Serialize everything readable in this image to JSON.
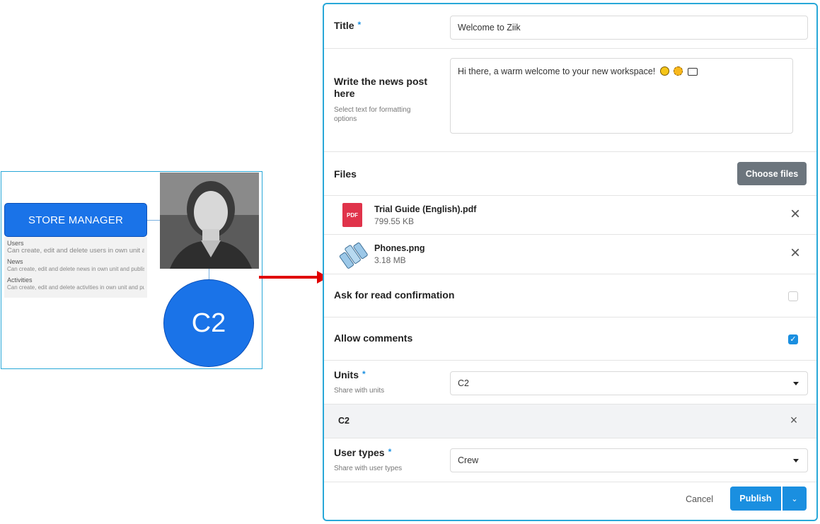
{
  "illustration": {
    "role_title": "STORE MANAGER",
    "permissions": [
      {
        "heading": "Users",
        "desc": "Can create, edit and delete users in own unit and below."
      },
      {
        "heading": "News",
        "desc": "Can create, edit and delete news in own unit and publish to own unit and below"
      },
      {
        "heading": "Activities",
        "desc": "Can create, edit and delete activities in own unit and publish to own unit and below"
      }
    ],
    "unit_label": "C2"
  },
  "form": {
    "title_label": "Title",
    "required_mark": "*",
    "title_value": "Welcome to Ziik",
    "post_label": "Write the news post here",
    "post_hint": "Select text for formatting options",
    "post_body": "Hi there, a warm welcome to your new workspace!",
    "files_label": "Files",
    "choose_files": "Choose files",
    "files": [
      {
        "name": "Trial Guide (English).pdf",
        "size": "799.55 KB",
        "icon": "pdf-icon",
        "badge": "PDF"
      },
      {
        "name": "Phones.png",
        "size": "3.18 MB",
        "icon": "image-thumbnail-icon"
      }
    ],
    "read_confirm_label": "Ask for read confirmation",
    "read_confirm_checked": false,
    "comments_label": "Allow comments",
    "comments_checked": true,
    "units_label": "Units",
    "units_hint": "Share with units",
    "units_value": "C2",
    "unit_chip": "C2",
    "user_types_label": "User types",
    "user_types_hint": "Share with user types",
    "user_types_value": "Crew",
    "cancel": "Cancel",
    "publish": "Publish"
  },
  "colors": {
    "accent": "#1a8fe0",
    "role_blue": "#1a73e8",
    "pdf_red": "#e0334a",
    "arrow_red": "#e00000",
    "frame_border": "#29a8d8"
  }
}
